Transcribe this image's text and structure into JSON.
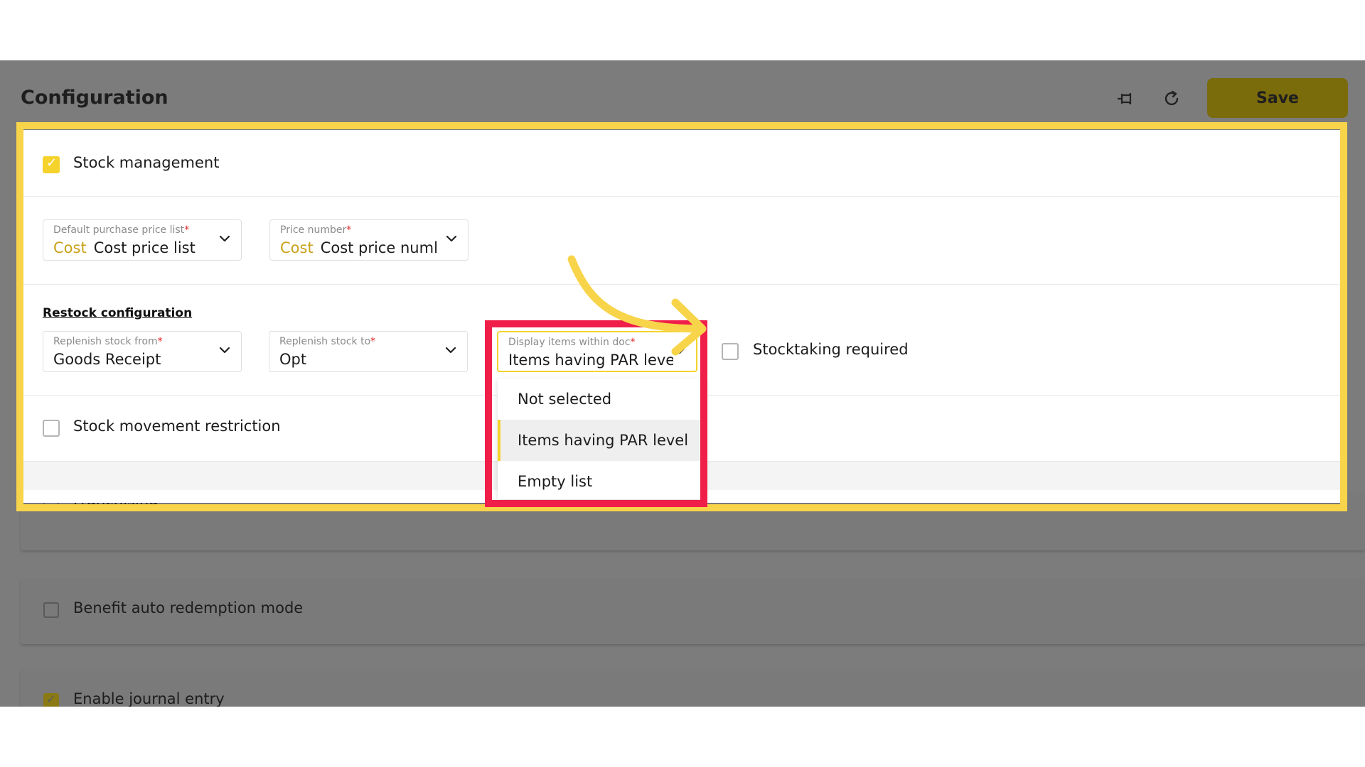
{
  "header": {
    "title": "Configuration",
    "pin_icon": "pin-icon",
    "refresh_icon": "refresh-icon",
    "save_label": "Save"
  },
  "stock_management": {
    "label": "Stock management",
    "checked": true,
    "default_price_list": {
      "label": "Default purchase price list",
      "required_mark": "*",
      "prefix": "Cost",
      "value": "Cost price list"
    },
    "price_number": {
      "label": "Price number",
      "required_mark": "*",
      "prefix": "Cost",
      "value": "Cost price numl"
    },
    "restock": {
      "section_title": "Restock configuration",
      "replenish_from": {
        "label": "Replenish stock from",
        "required_mark": "*",
        "value": "Goods Receipt"
      },
      "replenish_to": {
        "label": "Replenish stock to",
        "required_mark": "*",
        "value": "Opt"
      },
      "display_items": {
        "label": "Display items within doc",
        "required_mark": "*",
        "value": "Items having PAR leve",
        "options": [
          "Not selected",
          "Items having PAR level",
          "Empty list"
        ],
        "selected_index": 1
      },
      "stocktaking_required": {
        "label": "Stocktaking required",
        "checked": false
      }
    },
    "stock_movement_restriction": {
      "label": "Stock movement restriction",
      "checked": false
    }
  },
  "other_settings": [
    {
      "label": "Franchising",
      "checked": false
    },
    {
      "label": "Benefit auto redemption mode",
      "checked": false
    },
    {
      "label": "Enable journal entry",
      "checked": true
    }
  ],
  "colors": {
    "accent_yellow": "#f5d22c",
    "highlight_yellow": "#f8d44a",
    "highlight_red": "#ef1f4a",
    "overlay_gray": "#7c7c7c",
    "required_red": "#e02626"
  }
}
